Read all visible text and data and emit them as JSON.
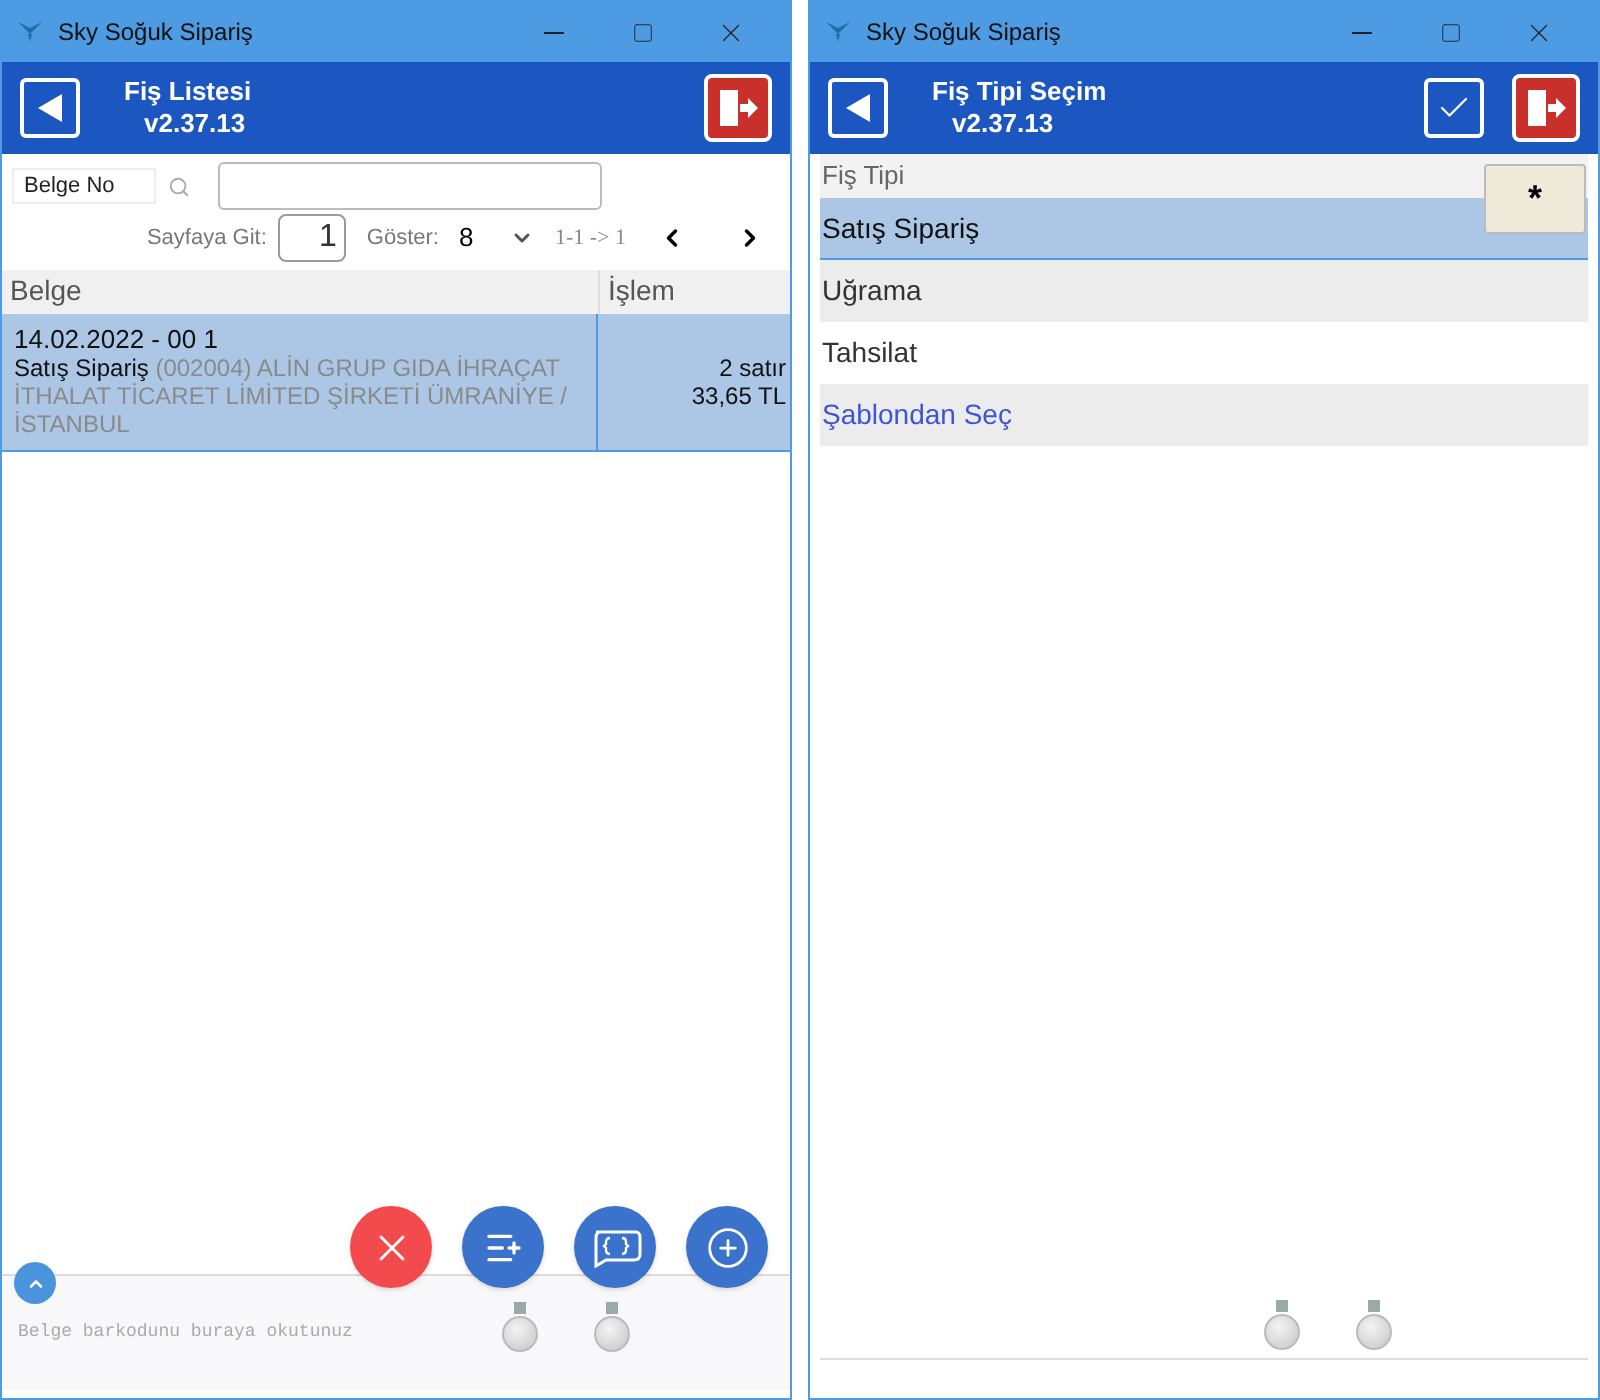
{
  "left_window": {
    "title": "Sky Soğuk Sipariş",
    "header_title": "Fiş Listesi",
    "version": "v2.37.13",
    "search": {
      "field_label": "Belge No"
    },
    "pager": {
      "goto_label": "Sayfaya Git:",
      "page": "1",
      "show_label": "Göster:",
      "page_size": "8",
      "range": "1-1 -> 1"
    },
    "table": {
      "columns": [
        "Belge",
        "İşlem"
      ],
      "rows": [
        {
          "selected": true,
          "date": "14.02.2022 - 00 1",
          "type": "Satış Sipariş",
          "customer": "(002004) ALİN GRUP GIDA İHRAÇAT İTHALAT TİCARET LİMİTED ŞİRKETİ  ÜMRANİYE / İSTANBUL",
          "lines": "2 satır",
          "total": "33,65 TL"
        }
      ]
    },
    "barcode_placeholder": "Belge barkodunu buraya okutunuz"
  },
  "right_window": {
    "title": "Sky Soğuk Sipariş",
    "header_title": "Fiş Tipi Seçim",
    "version": "v2.37.13",
    "list_label": "Fiş Tipi",
    "star_button": "*",
    "items": [
      {
        "label": "Satış Sipariş",
        "selected": true,
        "kind": "option"
      },
      {
        "label": "Uğrama",
        "selected": false,
        "kind": "option"
      },
      {
        "label": "Tahsilat",
        "selected": false,
        "kind": "option"
      },
      {
        "label": "Şablondan Seç",
        "selected": false,
        "kind": "link"
      }
    ]
  }
}
